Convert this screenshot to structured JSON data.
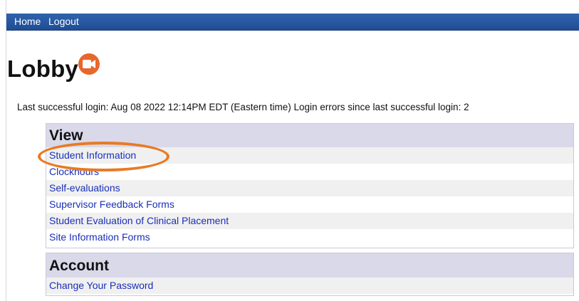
{
  "nav": {
    "home": "Home",
    "logout": "Logout"
  },
  "page": {
    "title": "Lobby",
    "title_icon": "video-camera-icon",
    "login_info": "Last successful login: Aug 08 2022 12:14PM EDT (Eastern time) Login errors since last successful login: 2"
  },
  "view": {
    "header": "View",
    "items": [
      {
        "label": "Student Information"
      },
      {
        "label": "Clockhours"
      },
      {
        "label": "Self-evaluations"
      },
      {
        "label": "Supervisor Feedback Forms"
      },
      {
        "label": "Student Evaluation of Clinical Placement"
      },
      {
        "label": "Site Information Forms"
      }
    ]
  },
  "account": {
    "header": "Account",
    "items": [
      {
        "label": "Change Your Password"
      }
    ]
  },
  "colors": {
    "navbar": "#2f63ad",
    "link": "#1a2fb7",
    "section_header": "#d9d9ea",
    "highlight": "#e87a25"
  }
}
